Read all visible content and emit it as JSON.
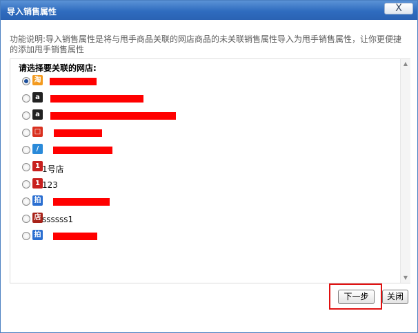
{
  "dialog": {
    "title": "导入销售属性",
    "close_label": "X",
    "description": "功能说明:导入销售属性是将与甩手商品关联的网店商品的未关联销售属性导入为甩手销售属性，让你更便捷的添加甩手销售属性",
    "list_heading": "请选择要关联的网店:"
  },
  "shops": [
    {
      "icon": "taobao-icon",
      "icon_glyph": "淘",
      "icon_color": "#f39a1e",
      "name": "",
      "selected": true
    },
    {
      "icon": "amazon-icon",
      "icon_glyph": "a",
      "icon_color": "#222222",
      "name": "",
      "selected": false
    },
    {
      "icon": "amazon-icon",
      "icon_glyph": "a",
      "icon_color": "#222222",
      "name": "",
      "selected": false
    },
    {
      "icon": "shop-bag-icon",
      "icon_glyph": "□",
      "icon_color": "#d9301f",
      "name": "",
      "selected": false
    },
    {
      "icon": "paipai-icon",
      "icon_glyph": "/",
      "icon_color": "#2a8ad9",
      "name": "",
      "selected": false
    },
    {
      "icon": "yhd-icon",
      "icon_glyph": "1",
      "icon_color": "#c8201e",
      "name": "1号店",
      "selected": false
    },
    {
      "icon": "yhd-icon",
      "icon_glyph": "1",
      "icon_color": "#c8201e",
      "name": "123",
      "selected": false
    },
    {
      "icon": "paipai-circle-icon",
      "icon_glyph": "拍",
      "icon_color": "#2b6fd1",
      "name": "",
      "selected": false
    },
    {
      "icon": "store-icon",
      "icon_glyph": "店",
      "icon_color": "#a8231a",
      "name": "ssssss1",
      "selected": false
    },
    {
      "icon": "paipai-circle-icon",
      "icon_glyph": "拍",
      "icon_color": "#2b6fd1",
      "name": "",
      "selected": false
    }
  ],
  "buttons": {
    "next": "下一步",
    "close": "关闭"
  },
  "colors": {
    "title_bar": "#2f6cbf",
    "highlight": "#e01010",
    "redaction": "#ff0000"
  }
}
